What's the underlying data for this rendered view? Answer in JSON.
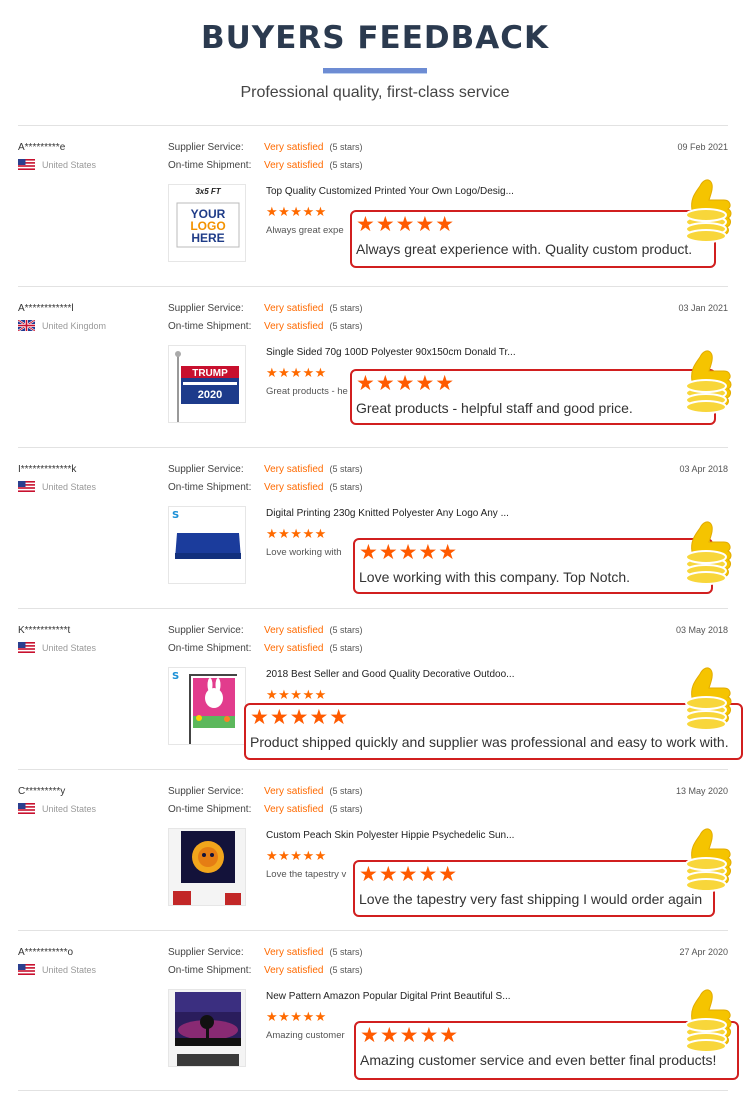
{
  "header": {
    "title": "BUYERS FEEDBACK",
    "subtitle": "Professional quality, first-class service"
  },
  "labels": {
    "supplier_service": "Supplier Service:",
    "ontime_shipment": "On-time Shipment:"
  },
  "colors": {
    "accent": "#ff6a00",
    "callout_border": "#d11f1f",
    "title": "#2b3a4f",
    "thumb_gold": "#f5c400"
  },
  "reviews": [
    {
      "buyer": "A*********e",
      "country": "United States",
      "flag": "us-flag-icon",
      "supplier_service": "Very satisfied",
      "supplier_stars": "(5 stars)",
      "ontime_shipment": "Very satisfied",
      "ontime_stars": "(5 stars)",
      "date": "09 Feb 2021",
      "product_title": "Top Quality Customized Printed Your Own Logo/Desig...",
      "stars": "★★★★★",
      "comment_preview": "Always great expe",
      "callout": "Always great experience with. Quality custom product.",
      "thumb": {
        "size": "3x5 FT",
        "line1": "YOUR",
        "line2": "LOGO",
        "line3": "HERE"
      }
    },
    {
      "buyer": "A************l",
      "country": "United Kingdom",
      "flag": "uk-flag-icon",
      "supplier_service": "Very satisfied",
      "supplier_stars": "(5 stars)",
      "ontime_shipment": "Very satisfied",
      "ontime_stars": "(5 stars)",
      "date": "03 Jan 2021",
      "product_title": "Single Sided 70g 100D Polyester 90x150cm Donald Tr...",
      "stars": "★★★★★",
      "comment_preview": "Great products - he",
      "callout": "Great products - helpful staff and good price.",
      "thumb": {
        "line1": "TRUMP",
        "line2": "2020"
      }
    },
    {
      "buyer": "I*************k",
      "country": "United States",
      "flag": "us-flag-icon",
      "supplier_service": "Very satisfied",
      "supplier_stars": "(5 stars)",
      "ontime_shipment": "Very satisfied",
      "ontime_stars": "(5 stars)",
      "date": "03 Apr 2018",
      "product_title": "Digital Printing 230g Knitted Polyester Any Logo Any ...",
      "stars": "★★★★★",
      "comment_preview": "Love working with",
      "callout": "Love working with this company. Top Notch."
    },
    {
      "buyer": "K***********t",
      "country": "United States",
      "flag": "us-flag-icon",
      "supplier_service": "Very satisfied",
      "supplier_stars": "(5 stars)",
      "ontime_shipment": "Very satisfied",
      "ontime_stars": "(5 stars)",
      "date": "03 May 2018",
      "product_title": "2018 Best Seller and Good Quality Decorative Outdoo...",
      "stars": "★★★★★",
      "comment_preview": "",
      "callout": "Product shipped quickly and supplier was professional and easy to work with."
    },
    {
      "buyer": "C*********y",
      "country": "United States",
      "flag": "us-flag-icon",
      "supplier_service": "Very satisfied",
      "supplier_stars": "(5 stars)",
      "ontime_shipment": "Very satisfied",
      "ontime_stars": "(5 stars)",
      "date": "13 May 2020",
      "product_title": "Custom Peach Skin Polyester Hippie Psychedelic Sun...",
      "stars": "★★★★★",
      "comment_preview": "Love the tapestry v",
      "callout": "Love the tapestry very fast shipping I would order again"
    },
    {
      "buyer": "A***********o",
      "country": "United States",
      "flag": "us-flag-icon",
      "supplier_service": "Very satisfied",
      "supplier_stars": "(5 stars)",
      "ontime_shipment": "Very satisfied",
      "ontime_stars": "(5 stars)",
      "date": "27 Apr 2020",
      "product_title": "New Pattern Amazon Popular Digital Print Beautiful S...",
      "stars": "★★★★★",
      "comment_preview": "Amazing customer",
      "callout": "Amazing customer service and even better final products!"
    }
  ]
}
